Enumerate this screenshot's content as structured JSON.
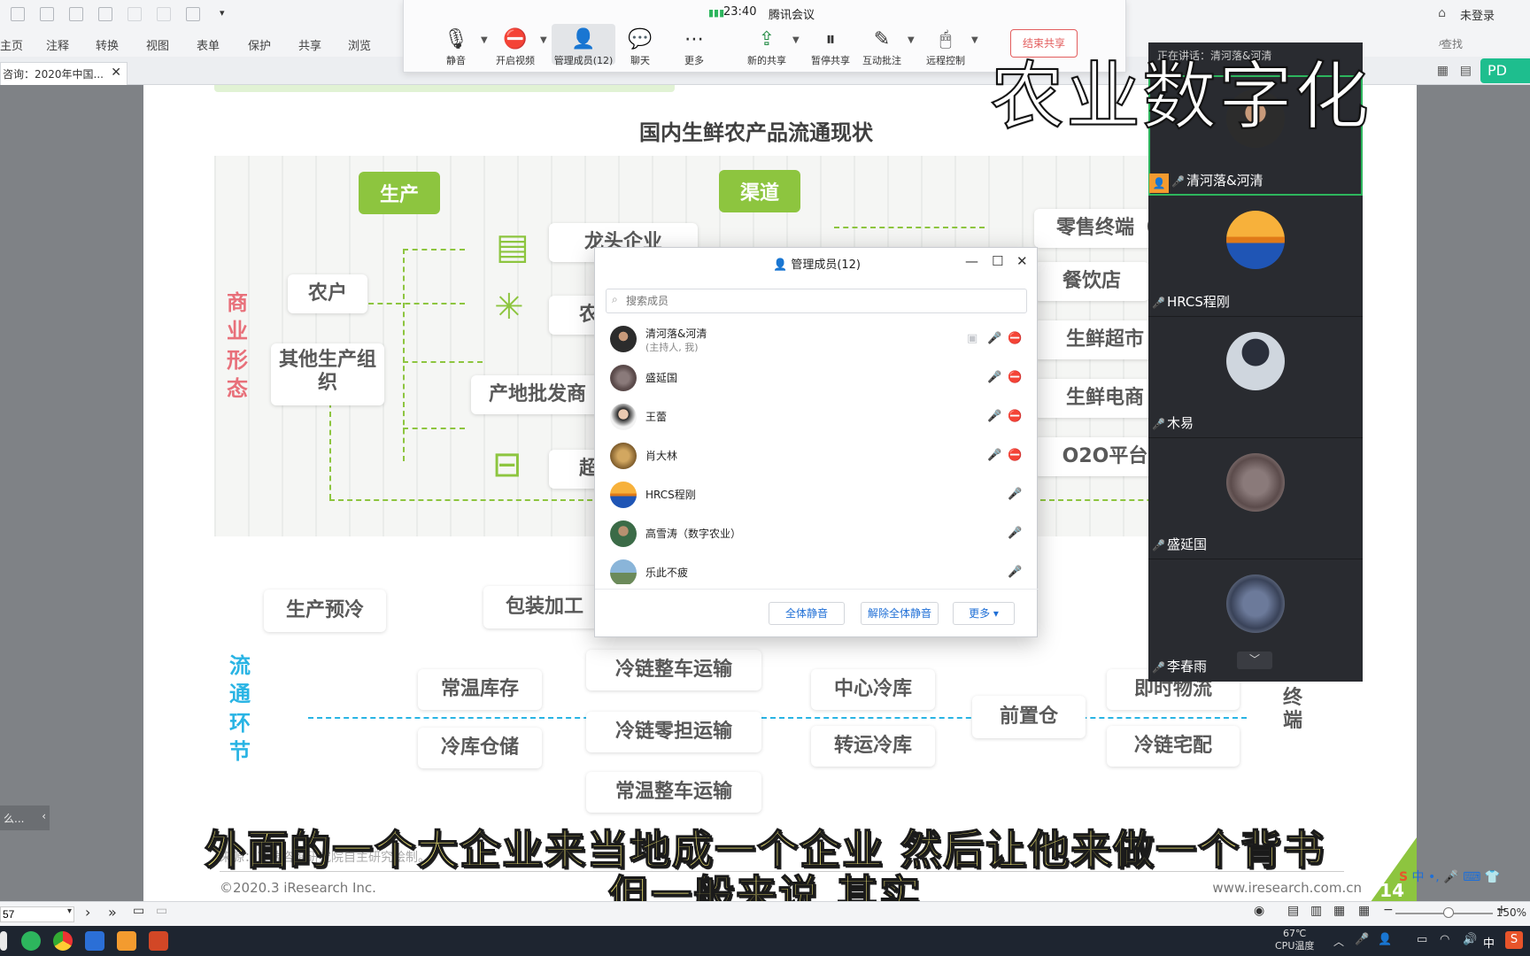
{
  "pdf_app": {
    "menu": [
      "主页",
      "注释",
      "转换",
      "视图",
      "表单",
      "保护",
      "共享",
      "浏览"
    ],
    "doc_tab": "咨询：2020年中国...",
    "login": "未登录",
    "search_placeholder": "查找",
    "pdf_badge": "PD",
    "page_number": "57",
    "zoom": "150%",
    "side_tab": "么..."
  },
  "meeting": {
    "time": "23:40",
    "app_name": "腾讯会议",
    "tools": [
      {
        "label": "静音",
        "icon": "mic-icon"
      },
      {
        "label": "开启视频",
        "icon": "camera-off-icon"
      },
      {
        "label": "管理成员(12)",
        "icon": "person-icon"
      },
      {
        "label": "聊天",
        "icon": "chat-icon"
      },
      {
        "label": "更多",
        "icon": "more-icon"
      },
      {
        "label": "新的共享",
        "icon": "share-icon"
      },
      {
        "label": "暂停共享",
        "icon": "pause-icon"
      },
      {
        "label": "互动批注",
        "icon": "annotate-icon"
      },
      {
        "label": "远程控制",
        "icon": "remote-icon"
      }
    ],
    "end_share": "结束共享"
  },
  "video_panel": {
    "title": "正在讲话：清河落&河清",
    "participants": [
      {
        "name": "清河落&河清",
        "muted": false,
        "host": true
      },
      {
        "name": "HRCS程刚",
        "muted": true
      },
      {
        "name": "木易",
        "muted": true
      },
      {
        "name": "盛延国",
        "muted": true
      },
      {
        "name": "李春雨",
        "muted": true
      }
    ]
  },
  "members_dialog": {
    "title": "管理成员(12)",
    "search_placeholder": "搜索成员",
    "members": [
      {
        "name": "清河落&河清",
        "sub": "(主持人, 我)"
      },
      {
        "name": "盛延国",
        "sub": ""
      },
      {
        "name": "王蕾",
        "sub": ""
      },
      {
        "name": "肖大林",
        "sub": ""
      },
      {
        "name": "HRCS程刚",
        "sub": ""
      },
      {
        "name": "高雪涛（数字农业）",
        "sub": ""
      },
      {
        "name": "乐此不疲",
        "sub": ""
      }
    ],
    "buttons": {
      "mute_all": "全体静音",
      "unmute_all": "解除全体静音",
      "more": "更多 ▾"
    }
  },
  "slide": {
    "title": "国内生鲜农产品流通现状",
    "tag_production": "生产",
    "tag_channel": "渠道",
    "label_business": "商业形态",
    "label_circulation": "流通环节",
    "producers": [
      "农户",
      "其他生产组织"
    ],
    "middle": [
      "龙头企业",
      "农",
      "产地批发商",
      "超"
    ],
    "channels": [
      "零售终端（",
      "餐饮店",
      "生鲜超市",
      "生鲜电商",
      "O2O平台"
    ],
    "process": [
      "生产预冷",
      "包装加工"
    ],
    "storage": [
      "常温库存",
      "冷库仓储"
    ],
    "transport": [
      "冷链整车运输",
      "冷链零担运输",
      "常温整车运输"
    ],
    "warehouse": [
      "中心冷库",
      "转运冷库"
    ],
    "front": "前置仓",
    "delivery": [
      "即时物流",
      "冷链宅配"
    ],
    "terminal": "终端",
    "footer_left": "©2020.3 iResearch Inc.",
    "footer_right": "www.iresearch.com.cn",
    "source": "来源：艾瑞咨询研究院自主研究绘制。",
    "page": "14"
  },
  "overlay": {
    "title": "农业数字化",
    "subtitle_line1": "外面的一个大企业来当地成一个企业  然后让他来做一个背书",
    "subtitle_line2": "但一般来说  其实"
  },
  "taskbar": {
    "cpu_temp": "67℃",
    "cpu_label": "CPU温度",
    "ime": "中"
  },
  "colors": {
    "accent_green": "#8dc53f",
    "business_red": "#e8707a",
    "circulation_blue": "#29b4e4"
  }
}
